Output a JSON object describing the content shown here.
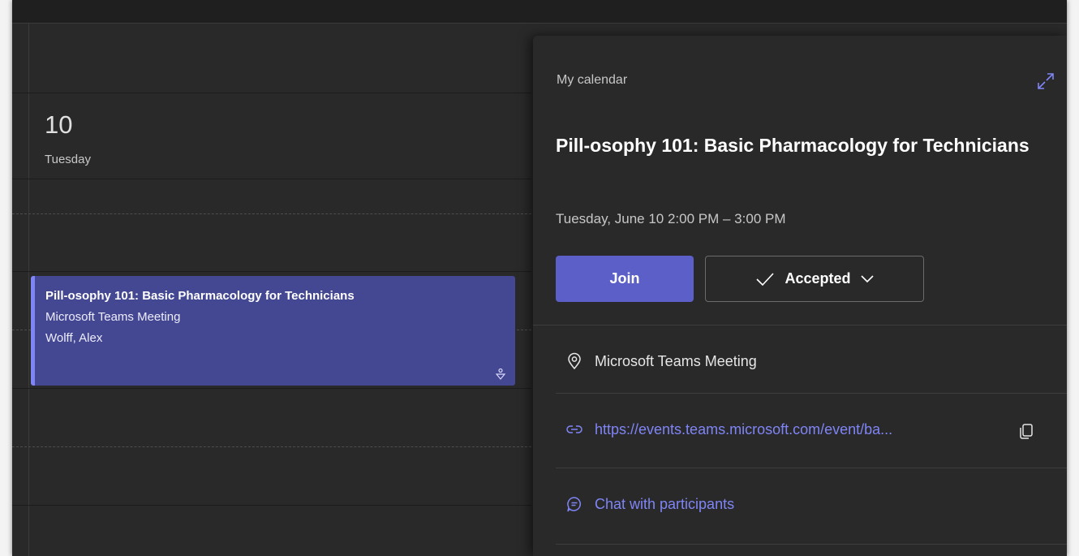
{
  "calendar": {
    "day_number": "10",
    "day_name": "Tuesday",
    "event": {
      "title": "Pill-osophy 101: Basic Pharmacology for Technicians",
      "location": "Microsoft Teams Meeting",
      "organizer": "Wolff, Alex",
      "icon": "person-icon"
    }
  },
  "panel": {
    "calendar_name": "My calendar",
    "expand_icon": "expand-icon",
    "title": "Pill-osophy 101: Basic Pharmacology for Technicians",
    "datetime": "Tuesday, June 10 2:00 PM – 3:00 PM",
    "join_label": "Join",
    "rsvp_label": "Accepted",
    "location": "Microsoft Teams Meeting",
    "link": "https://events.teams.microsoft.com/event/ba...",
    "chat_label": "Chat with participants"
  },
  "colors": {
    "background": "#292929",
    "accent": "#5b5fc7",
    "event_fill": "#444791",
    "link": "#7f85f5"
  }
}
